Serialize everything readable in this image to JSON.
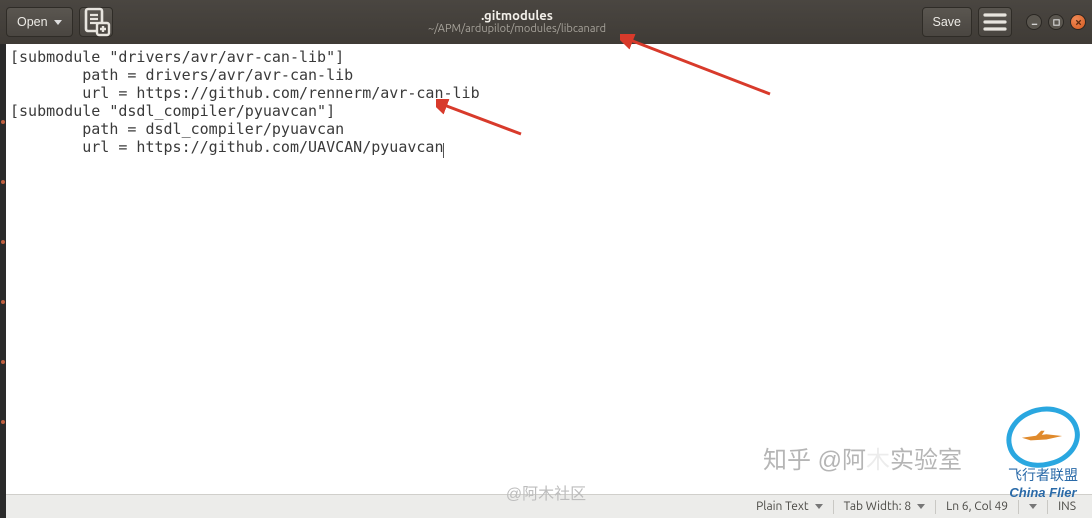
{
  "header": {
    "open_label": "Open",
    "save_label": "Save",
    "title": ".gitmodules",
    "subtitle": "~/APM/ardupilot/modules/libcanard"
  },
  "editor": {
    "lines": [
      "[submodule \"drivers/avr/avr-can-lib\"]",
      "        path = drivers/avr/avr-can-lib",
      "        url = https://github.com/rennerm/avr-can-lib",
      "[submodule \"dsdl_compiler/pyuavcan\"]",
      "        path = dsdl_compiler/pyuavcan",
      "        url = https://github.com/UAVCAN/pyuavcan"
    ],
    "caret_line": 5,
    "caret_col": 49
  },
  "status": {
    "syntax": "Plain Text",
    "tab_width_label": "Tab Width: 8",
    "position": "Ln 6, Col 49",
    "insert_mode": "INS"
  },
  "watermarks": {
    "center": "@阿木社区",
    "right_zh_prefix": "知乎 @阿",
    "right_zh_suffix": "实验室",
    "logo_cn": "飞行者联盟",
    "logo_en": "China Flier"
  }
}
